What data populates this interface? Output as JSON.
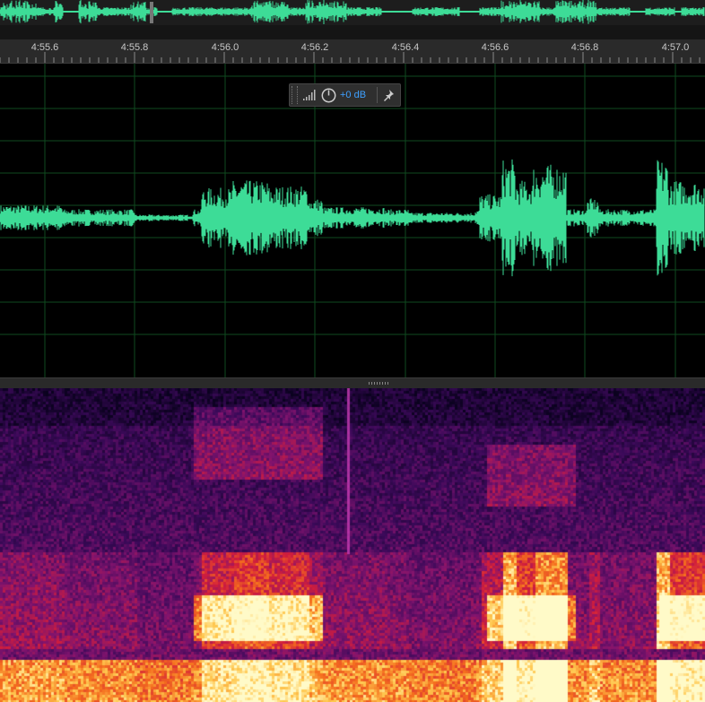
{
  "timeline": {
    "ticks": [
      "4:55.6",
      "4:55.8",
      "4:56.0",
      "4:56.2",
      "4:56.4",
      "4:56.6",
      "4:56.8",
      "4:57.0"
    ]
  },
  "hud": {
    "volume_label": "+0 dB",
    "icons": [
      "level-meter-icon",
      "volume-knob-icon",
      "pin-icon"
    ]
  },
  "colors": {
    "waveform": "#3ddc97",
    "grid": "#0f4a1f",
    "ruler_bg": "#2a2a2a",
    "accent": "#3ea0ff"
  }
}
